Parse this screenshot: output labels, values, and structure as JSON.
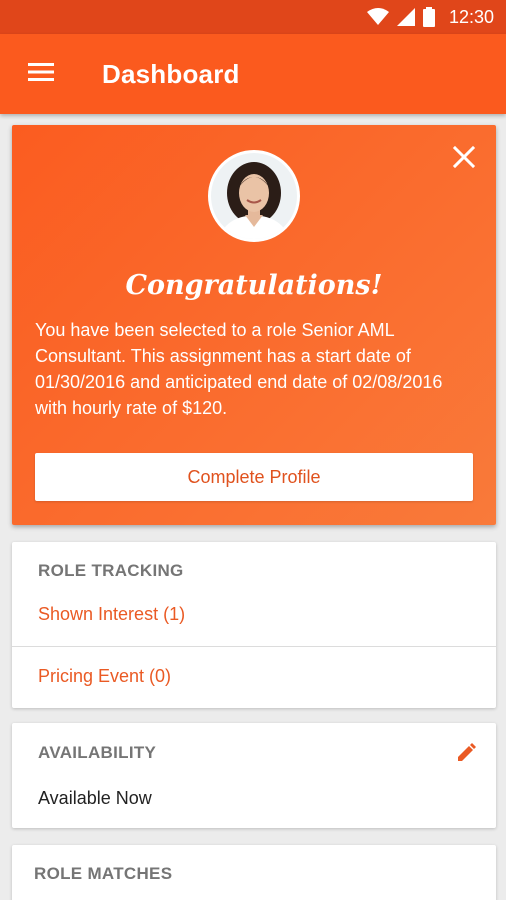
{
  "status_bar": {
    "time": "12:30",
    "icons": [
      "wifi-icon",
      "signal-icon",
      "battery-icon"
    ]
  },
  "app_bar": {
    "title": "Dashboard",
    "menu_icon": "hamburger-menu-icon",
    "color": "#fb5a1e"
  },
  "congrats": {
    "title": "Congratulations!",
    "message": "You have been selected to a role Senior AML Consultant. This assignment has a start date of 01/30/2016 and anticipated end date of 02/08/2016 with hourly rate of $120.",
    "button_label": "Complete Profile",
    "close_icon": "close-icon",
    "avatar": "profile-photo"
  },
  "role_tracking": {
    "header": "ROLE TRACKING",
    "items": [
      {
        "label": "Shown Interest (1)"
      },
      {
        "label": "Pricing Event (0)"
      }
    ]
  },
  "availability": {
    "header": "AVAILABILITY",
    "value": "Available Now",
    "edit_icon": "pencil-icon"
  },
  "role_matches": {
    "header": "ROLE MATCHES"
  },
  "colors": {
    "accent": "#fb5a1e",
    "status_bar": "#e0461a",
    "link": "#ea5a24"
  }
}
